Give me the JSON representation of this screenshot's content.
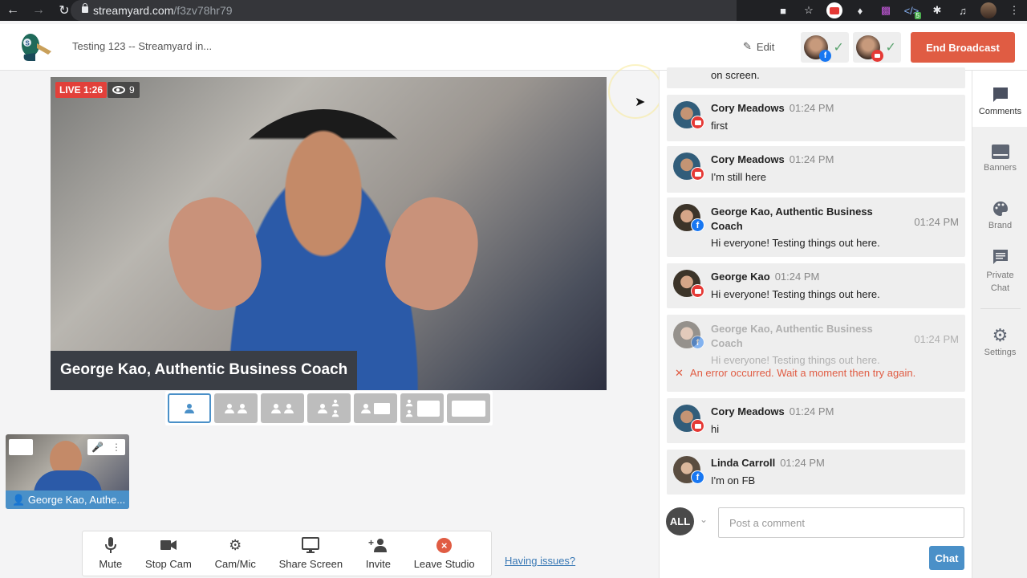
{
  "browser": {
    "url_host": "streamyard.com",
    "url_path": "/f3zv78hr79",
    "extension_badge": "5"
  },
  "header": {
    "broadcast_title": "Testing 123 -- Streamyard in...",
    "edit_label": "Edit",
    "destinations": [
      {
        "network": "facebook",
        "status": "connected"
      },
      {
        "network": "youtube",
        "status": "connected"
      }
    ],
    "end_broadcast_label": "End Broadcast"
  },
  "stage": {
    "live_label": "LIVE 1:26",
    "viewer_count": "9",
    "lower_third": "George Kao, Authentic Business Coach",
    "layouts": [
      {
        "name": "solo",
        "active": true
      },
      {
        "name": "thin",
        "active": false
      },
      {
        "name": "group",
        "active": false
      },
      {
        "name": "leader",
        "active": false
      },
      {
        "name": "screen",
        "active": false
      },
      {
        "name": "pip-screen",
        "active": false
      },
      {
        "name": "full-screen",
        "active": false
      }
    ]
  },
  "preview": {
    "name": "George Kao, Authe..."
  },
  "toolbar": {
    "mute": "Mute",
    "stop_cam": "Stop Cam",
    "cam_mic": "Cam/Mic",
    "share_screen": "Share Screen",
    "invite": "Invite",
    "leave_studio": "Leave Studio",
    "having_issues": "Having issues?"
  },
  "chat": {
    "partial_text": "on screen.",
    "messages": [
      {
        "name": "Cory Meadows",
        "time": "01:24 PM",
        "text": "first",
        "network": "youtube"
      },
      {
        "name": "Cory Meadows",
        "time": "01:24 PM",
        "text": "I'm still here",
        "network": "youtube"
      },
      {
        "name": "George Kao, Authentic Business Coach",
        "time": "01:24 PM",
        "text": "Hi everyone! Testing things out here.",
        "network": "facebook"
      },
      {
        "name": "George Kao",
        "time": "01:24 PM",
        "text": "Hi everyone! Testing things out here.",
        "network": "youtube"
      },
      {
        "name": "George Kao, Authentic Business Coach",
        "time": "01:24 PM",
        "text": "Hi everyone! Testing things out here.",
        "network": "facebook",
        "failed": true,
        "error": "An error occurred. Wait a moment then try again."
      },
      {
        "name": "Cory Meadows",
        "time": "01:24 PM",
        "text": "hi",
        "network": "youtube"
      },
      {
        "name": "Linda Carroll",
        "time": "01:24 PM",
        "text": "I'm on FB",
        "network": "facebook"
      }
    ],
    "audience_selector": "ALL",
    "comment_placeholder": "Post a comment",
    "send_label": "Chat"
  },
  "rail": {
    "items": [
      {
        "label": "Comments",
        "active": true
      },
      {
        "label": "Banners",
        "active": false
      },
      {
        "label": "Brand",
        "active": false
      },
      {
        "label": "Private Chat",
        "active": false
      },
      {
        "label": "Settings",
        "active": false
      }
    ]
  },
  "colors": {
    "accent": "#4a90c8",
    "danger": "#e05c43",
    "live": "#e2403a"
  }
}
